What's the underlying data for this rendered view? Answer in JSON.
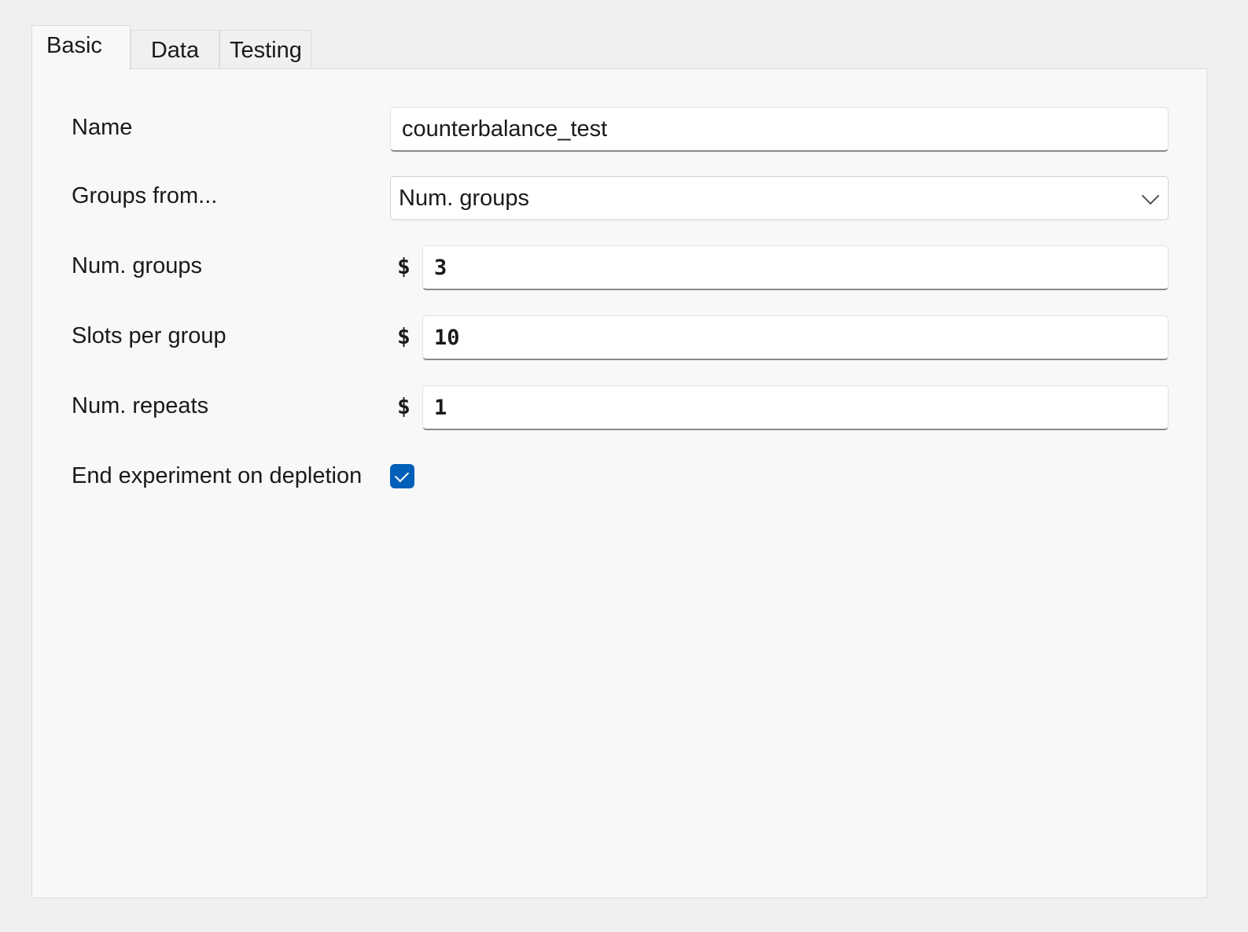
{
  "tabs": [
    {
      "label": "Basic",
      "active": true
    },
    {
      "label": "Data",
      "active": false
    },
    {
      "label": "Testing",
      "active": false
    }
  ],
  "form": {
    "name": {
      "label": "Name",
      "value": "counterbalance_test"
    },
    "groups_from": {
      "label": "Groups from...",
      "selected": "Num. groups"
    },
    "num_groups": {
      "label": "Num. groups",
      "prefix": "$",
      "value": "3"
    },
    "slots_per_group": {
      "label": "Slots per group",
      "prefix": "$",
      "value": "10"
    },
    "num_repeats": {
      "label": "Num. repeats",
      "prefix": "$",
      "value": "1"
    },
    "end_on_depletion": {
      "label": "End experiment on depletion",
      "checked": true
    }
  },
  "colors": {
    "accent": "#005fb8",
    "panel_bg": "#f8f8f8",
    "window_bg": "#f0f0f0"
  }
}
